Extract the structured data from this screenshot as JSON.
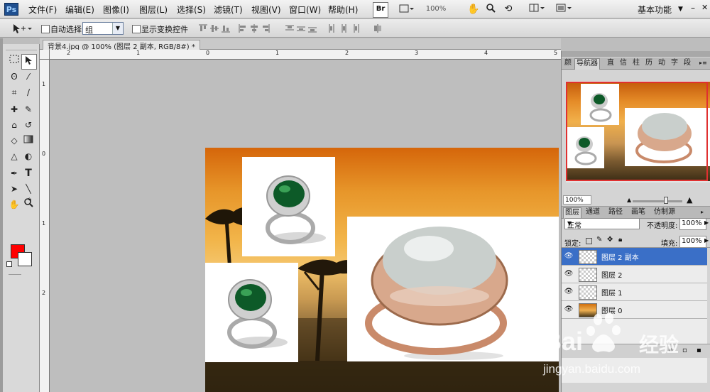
{
  "app": {
    "logo": "Ps"
  },
  "menu": [
    "文件(F)",
    "编辑(E)",
    "图像(I)",
    "图层(L)",
    "选择(S)",
    "滤镜(T)",
    "视图(V)",
    "窗口(W)",
    "帮助(H)"
  ],
  "appbar": {
    "br": "Br",
    "zoom": "100%",
    "workspace": "基本功能"
  },
  "options": {
    "auto_select_label": "自动选择:",
    "auto_select_value": "组",
    "show_transform_label": "显示变换控件"
  },
  "document": {
    "tab_title": "背景4.jpg @ 100% (图层 2 副本, RGB/8#) *"
  },
  "ruler": {
    "top": [
      "2",
      "1",
      "0",
      "1",
      "2",
      "3",
      "4",
      "5"
    ],
    "left": [
      "1",
      "0",
      "1",
      "2"
    ]
  },
  "colors": {
    "foreground": "#ff0000",
    "background": "#ffffff",
    "selection": "#3a6fc7"
  },
  "navigator": {
    "tabs": [
      "颜",
      "导航器",
      "直",
      "信",
      "柱",
      "历",
      "动",
      "字",
      "段"
    ],
    "active_tab": "导航器",
    "zoom": "100%"
  },
  "layers_panel": {
    "tabs": [
      "图层",
      "通道",
      "路径",
      "画笔",
      "仿制源"
    ],
    "active_tab": "图层",
    "blend_mode": "正常",
    "opacity_label": "不透明度:",
    "opacity": "100%",
    "lock_label": "锁定:",
    "fill_label": "填充:",
    "fill": "100%",
    "layers": [
      {
        "name": "图层 2 副本",
        "selected": true
      },
      {
        "name": "图层 2",
        "selected": false
      },
      {
        "name": "图层 1",
        "selected": false
      },
      {
        "name": "图层 0",
        "selected": false
      }
    ]
  },
  "watermark": {
    "brand": "Bai",
    "brand_cn": "经验",
    "url": "jingyan.baidu.com"
  },
  "icons": [
    "move-tool-icon",
    "marquee-icon",
    "lasso-icon",
    "crop-icon",
    "eyedropper-icon",
    "brush-icon",
    "eraser-icon",
    "gradient-icon",
    "pen-icon",
    "type-icon",
    "path-select-icon",
    "hand-icon",
    "zoom-icon",
    "eye-icon",
    "lock-icon"
  ]
}
